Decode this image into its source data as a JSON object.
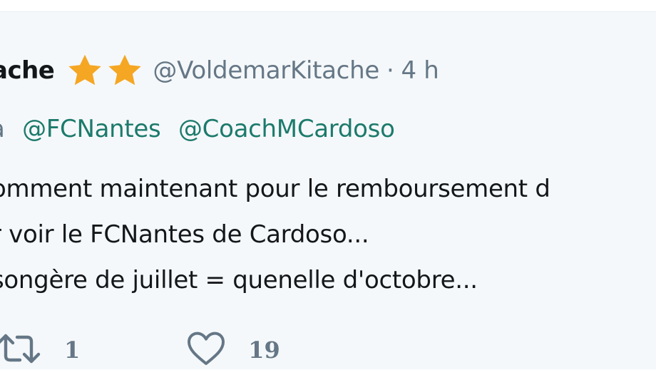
{
  "tweet": {
    "author_name": "ache",
    "handle": "@VoldemarKitache",
    "separator": "·",
    "timestamp": "4 h",
    "reply_prefix": "a",
    "mentions": [
      "@FCNantes",
      "@CoachMCardoso"
    ],
    "lines": [
      "omment maintenant pour le remboursement d",
      "r voir le FCNantes de Cardoso...",
      "songère de juillet = quenelle d'octobre..."
    ],
    "retweet_count": "1",
    "like_count": "19"
  },
  "colors": {
    "star": "#f5a623",
    "mention": "#1c7a6c",
    "muted": "#657786",
    "text": "#14171a",
    "background": "#f5f8fa"
  },
  "icons": {
    "badge": "star-icon",
    "retweet": "retweet-icon",
    "like": "heart-icon"
  }
}
